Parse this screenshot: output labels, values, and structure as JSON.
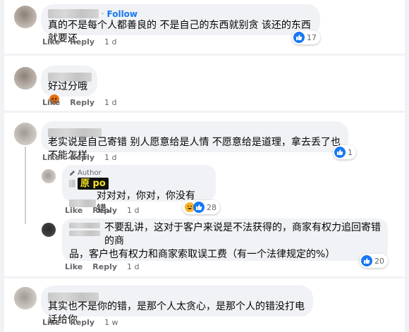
{
  "comments": [
    {
      "follow": "Follow",
      "text": "真的不是每个人都善良的 不是自己的东西就别贪 该还的东西就要还",
      "actions": {
        "like": "Like",
        "reply": "Reply",
        "time": "1 d"
      },
      "reaction_count": "17"
    },
    {
      "text": "好过分哦",
      "emoji": "angry-face",
      "actions": {
        "like": "Like",
        "reply": "Reply",
        "time": "1 d"
      }
    },
    {
      "text": "老实说是自己寄错 别人愿意给是人情 不愿意给是道理，拿去丢了也不能怎样",
      "actions": {
        "like": "Like",
        "reply": "Reply",
        "time": "1 d"
      },
      "reaction_count": "1",
      "replies": [
        {
          "badge": "Author",
          "po_tag": "原 po",
          "text": "对对对，你对，你没有错。",
          "actions": {
            "like": "Like",
            "reply": "Reply",
            "time": "1 d"
          },
          "reaction_count": "28"
        },
        {
          "text_line1": "不要乱讲，这对于客户来说是不法获得的，商家有权力追回寄错的商",
          "text_line2": "品，客户也有权力和商家索取误工费（有一个法律规定的%）",
          "actions": {
            "like": "Like",
            "reply": "Reply",
            "time": "1 d"
          },
          "reaction_count": "20"
        }
      ]
    },
    {
      "text": "其实也不是你的错，是那个人太贪心，是那个人的错没打电话给你",
      "actions": {
        "like": "Like",
        "reply": "Reply",
        "time": "1 w"
      }
    }
  ],
  "colors": {
    "accent": "#1877f2",
    "bubble": "#f0f2f5",
    "meta": "#65676b",
    "haha": "#f7b125",
    "angry": "#e9710f"
  }
}
